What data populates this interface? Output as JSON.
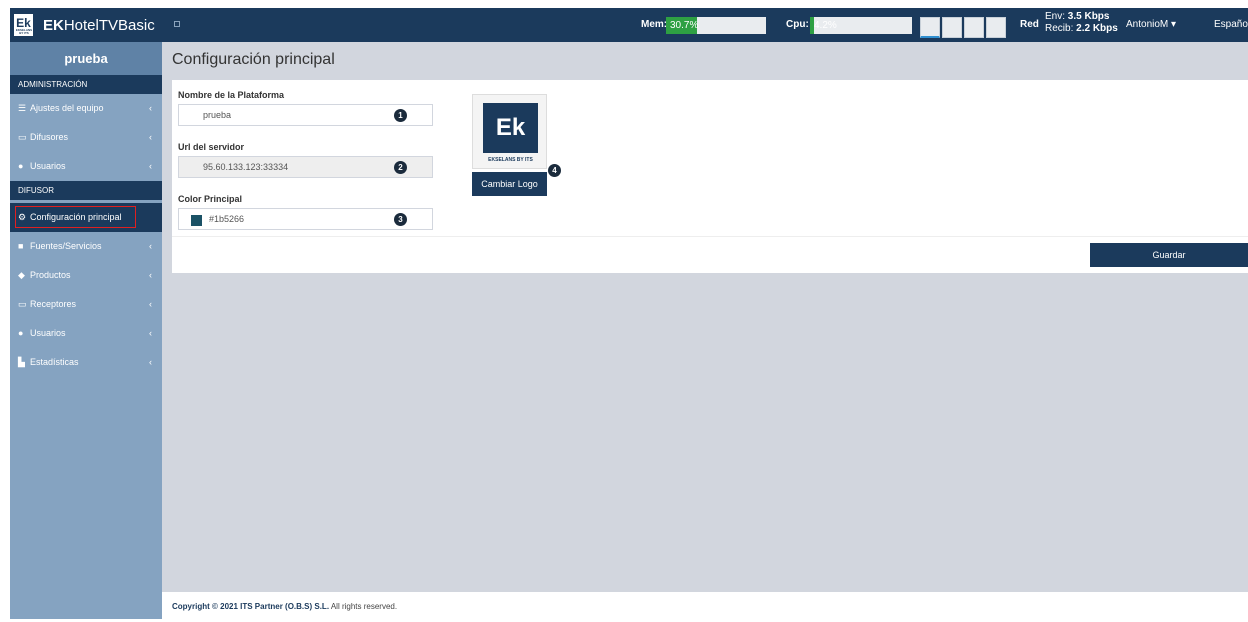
{
  "brand": {
    "logo_text": "Ek",
    "logo_sub": "EKSELANS BY ITS",
    "name_bold": "EK",
    "name_rest": "HotelTVBasic"
  },
  "header": {
    "mem_label": "Mem:",
    "mem_value": "30.7%",
    "mem_fraction": 0.307,
    "cpu_label": "Cpu:",
    "cpu_value": "4.2%",
    "cpu_fraction": 0.042,
    "red_label": "Red",
    "env_label": "Env:",
    "env_value": "3.5 Kbps",
    "recib_label": "Recib:",
    "recib_value": "2.2 Kbps",
    "user": "AntonioM",
    "language": "Español"
  },
  "sidebar": {
    "user": "prueba",
    "section_admin": "ADMINISTRACIÓN",
    "admin_items": [
      {
        "label": "Ajustes del equipo",
        "icon": "bars-icon"
      },
      {
        "label": "Difusores",
        "icon": "monitor-icon"
      },
      {
        "label": "Usuarios",
        "icon": "users-icon"
      }
    ],
    "section_difusor": "DIFUSOR",
    "active_item": "Configuración principal",
    "difusor_items": [
      {
        "label": "Fuentes/Servicios",
        "icon": "video-icon"
      },
      {
        "label": "Productos",
        "icon": "cubes-icon"
      },
      {
        "label": "Receptores",
        "icon": "tv-icon"
      },
      {
        "label": "Usuarios",
        "icon": "user-icon"
      },
      {
        "label": "Estadísticas",
        "icon": "chart-icon"
      }
    ]
  },
  "main": {
    "title": "Configuración principal",
    "platform_label": "Nombre de la Plataforma",
    "platform_value": "prueba",
    "server_label": "Url del servidor",
    "server_value": "95.60.133.123:33334",
    "color_label": "Color Principal",
    "color_value": "#1b5266",
    "change_logo": "Cambiar Logo",
    "save": "Guardar",
    "badges": [
      "1",
      "2",
      "3",
      "4"
    ]
  },
  "footer": {
    "prefix": "Copyright © 2021 ",
    "company": "ITS Partner (O.B.S) S.L.",
    "suffix": " All rights reserved."
  },
  "colors": {
    "primary": "#1b3a5c",
    "sidebar": "#85a3c1",
    "meter_fill": "#2ea043",
    "highlight": "#e02020",
    "swatch": "#1b5266"
  }
}
